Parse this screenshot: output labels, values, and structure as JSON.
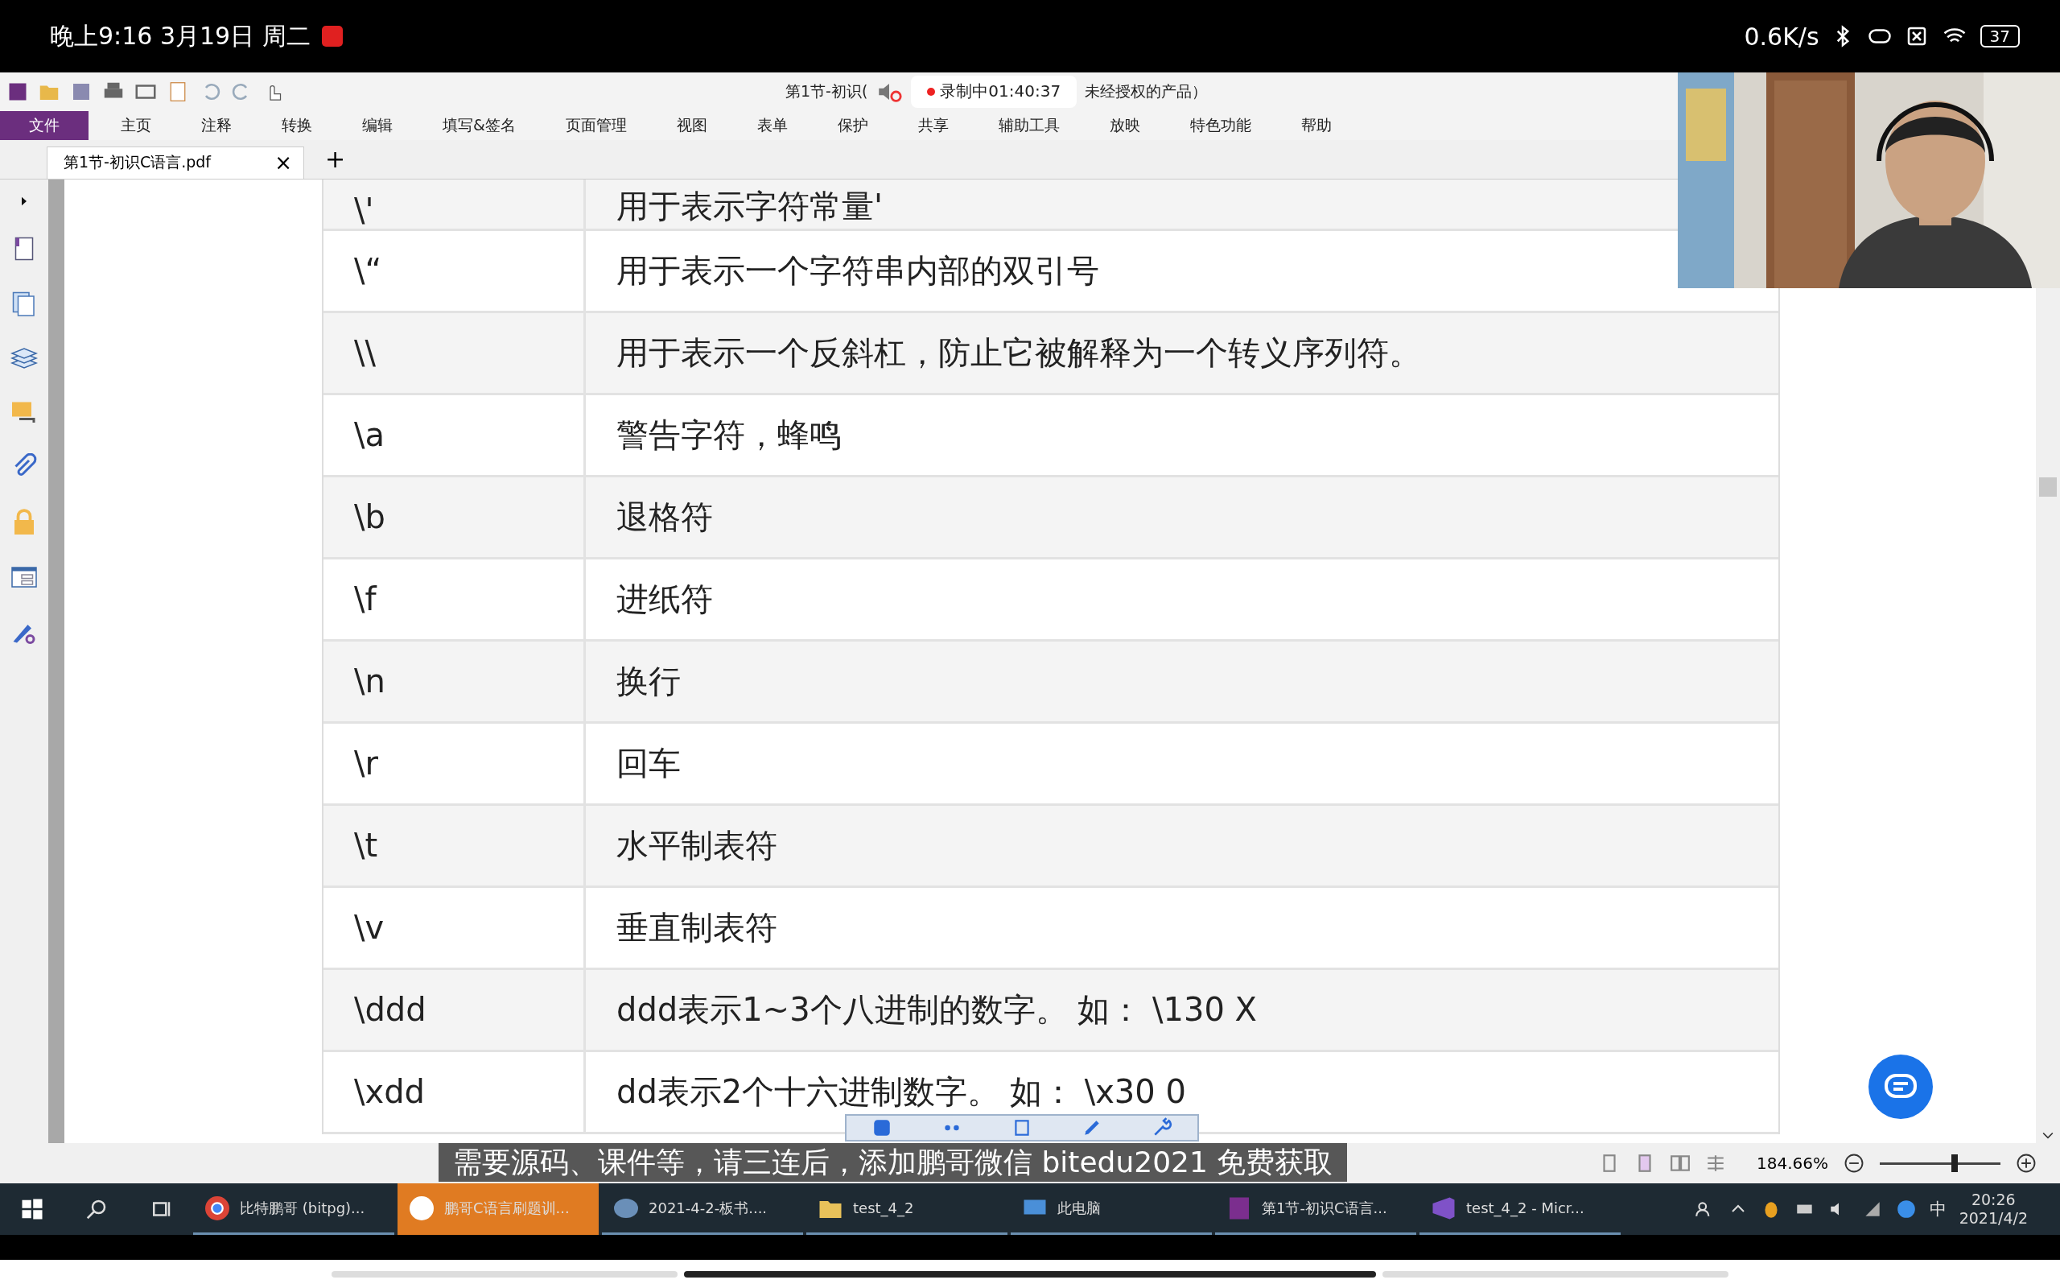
{
  "phone_status": {
    "time": "晚上9:16 3月19日 周二",
    "net_speed": "0.6K/s",
    "battery": "37"
  },
  "app": {
    "title_prefix": "第1节-初识(",
    "recording": "录制中01:40:37",
    "title_suffix": "未经授权的产品）",
    "menu": [
      {
        "label": "文件",
        "selected": true
      },
      {
        "label": "主页",
        "selected": false
      },
      {
        "label": "注释",
        "selected": false
      },
      {
        "label": "转换",
        "selected": false
      },
      {
        "label": "编辑",
        "selected": false
      },
      {
        "label": "填写&签名",
        "selected": false
      },
      {
        "label": "页面管理",
        "selected": false
      },
      {
        "label": "视图",
        "selected": false
      },
      {
        "label": "表单",
        "selected": false
      },
      {
        "label": "保护",
        "selected": false
      },
      {
        "label": "共享",
        "selected": false
      },
      {
        "label": "辅助工具",
        "selected": false
      },
      {
        "label": "放映",
        "selected": false
      },
      {
        "label": "特色功能",
        "selected": false
      },
      {
        "label": "帮助",
        "selected": false
      }
    ],
    "tabs": [
      {
        "label": "第1节-初识C语言.pdf",
        "close": "×",
        "selected": true
      }
    ],
    "new_tab": "+",
    "table": {
      "rows": [
        {
          "code": "\\'",
          "meaning": "用于表示字符常量'"
        },
        {
          "code": "\\“",
          "meaning": "用于表示一个字符串内部的双引号"
        },
        {
          "code": "\\\\",
          "meaning": "用于表示一个反斜杠，防止它被解释为一个转义序列符。"
        },
        {
          "code": "\\a",
          "meaning": "警告字符，蜂鸣"
        },
        {
          "code": "\\b",
          "meaning": "退格符"
        },
        {
          "code": "\\f",
          "meaning": "进纸符"
        },
        {
          "code": "\\n",
          "meaning": "换行"
        },
        {
          "code": "\\r",
          "meaning": "回车"
        },
        {
          "code": "\\t",
          "meaning": "水平制表符"
        },
        {
          "code": "\\v",
          "meaning": "垂直制表符"
        },
        {
          "code": "\\ddd",
          "meaning": "ddd表示1~3个八进制的数字。 如： \\130 X"
        },
        {
          "code": "\\xdd",
          "meaning": "dd表示2个十六进制数字。 如： \\x30 0"
        }
      ]
    },
    "status": {
      "zoom": "184.66%",
      "level": 0.62
    }
  },
  "taskbar": {
    "items": [
      {
        "kind": "browser",
        "label": "比特鹏哥 (bitpg)...",
        "active": false
      },
      {
        "kind": "app",
        "label": "鹏哥C语言刷题训...",
        "active": true
      },
      {
        "kind": "paint",
        "label": "2021-4-2-板书....",
        "active": false
      },
      {
        "kind": "folder",
        "label": "test_4_2",
        "active": false
      },
      {
        "kind": "computer",
        "label": "此电脑",
        "active": false
      },
      {
        "kind": "pdf",
        "label": "第1节-初识C语言...",
        "active": false
      },
      {
        "kind": "vs",
        "label": "test_4_2 - Micr...",
        "active": false
      }
    ],
    "ime": "中",
    "time": "20:26",
    "date": "2021/4/2"
  },
  "subtitle": "需要源码、课件等，请三连后，添加鹏哥微信 bitedu2021 免费获取"
}
